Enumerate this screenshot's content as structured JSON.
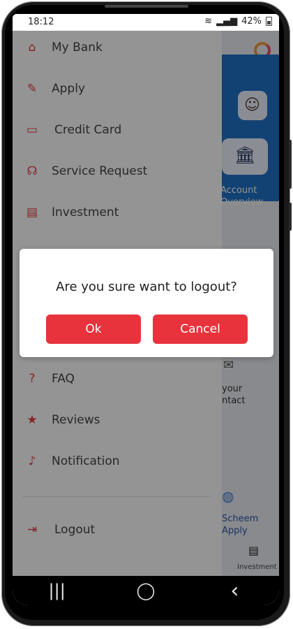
{
  "status_bar": {
    "time": "18:12",
    "battery": "42%"
  },
  "drawer": {
    "items": [
      {
        "label": "My Bank",
        "icon": "home-icon",
        "glyph": "⌂"
      },
      {
        "label": "Apply",
        "icon": "edit-icon",
        "glyph": "✎"
      },
      {
        "label": "Credit Card",
        "icon": "credit-card-icon",
        "glyph": "▭"
      },
      {
        "label": "Service Request",
        "icon": "headset-icon",
        "glyph": "☊"
      },
      {
        "label": "Investment",
        "icon": "document-icon",
        "glyph": "▤"
      },
      {
        "label": "FAQ",
        "icon": "question-icon",
        "glyph": "?"
      },
      {
        "label": "Reviews",
        "icon": "star-icon",
        "glyph": "★"
      },
      {
        "label": "Notification",
        "icon": "bell-icon",
        "glyph": "🔔"
      },
      {
        "label": "Logout",
        "icon": "logout-icon",
        "glyph": "⇥"
      }
    ]
  },
  "background": {
    "account_overview": [
      "Account",
      "Overview"
    ],
    "contact": [
      "your",
      "ntact"
    ],
    "scheme": [
      "Scheem",
      "Apply"
    ],
    "nav_label": "Investment"
  },
  "dialog": {
    "message": "Are you sure want to logout?",
    "ok_label": "Ok",
    "cancel_label": "Cancel"
  },
  "navbar": {
    "recent": "|||",
    "home": "◯",
    "back": "‹"
  },
  "colors": {
    "accent": "#e8333d",
    "blue": "#1f73c8"
  }
}
